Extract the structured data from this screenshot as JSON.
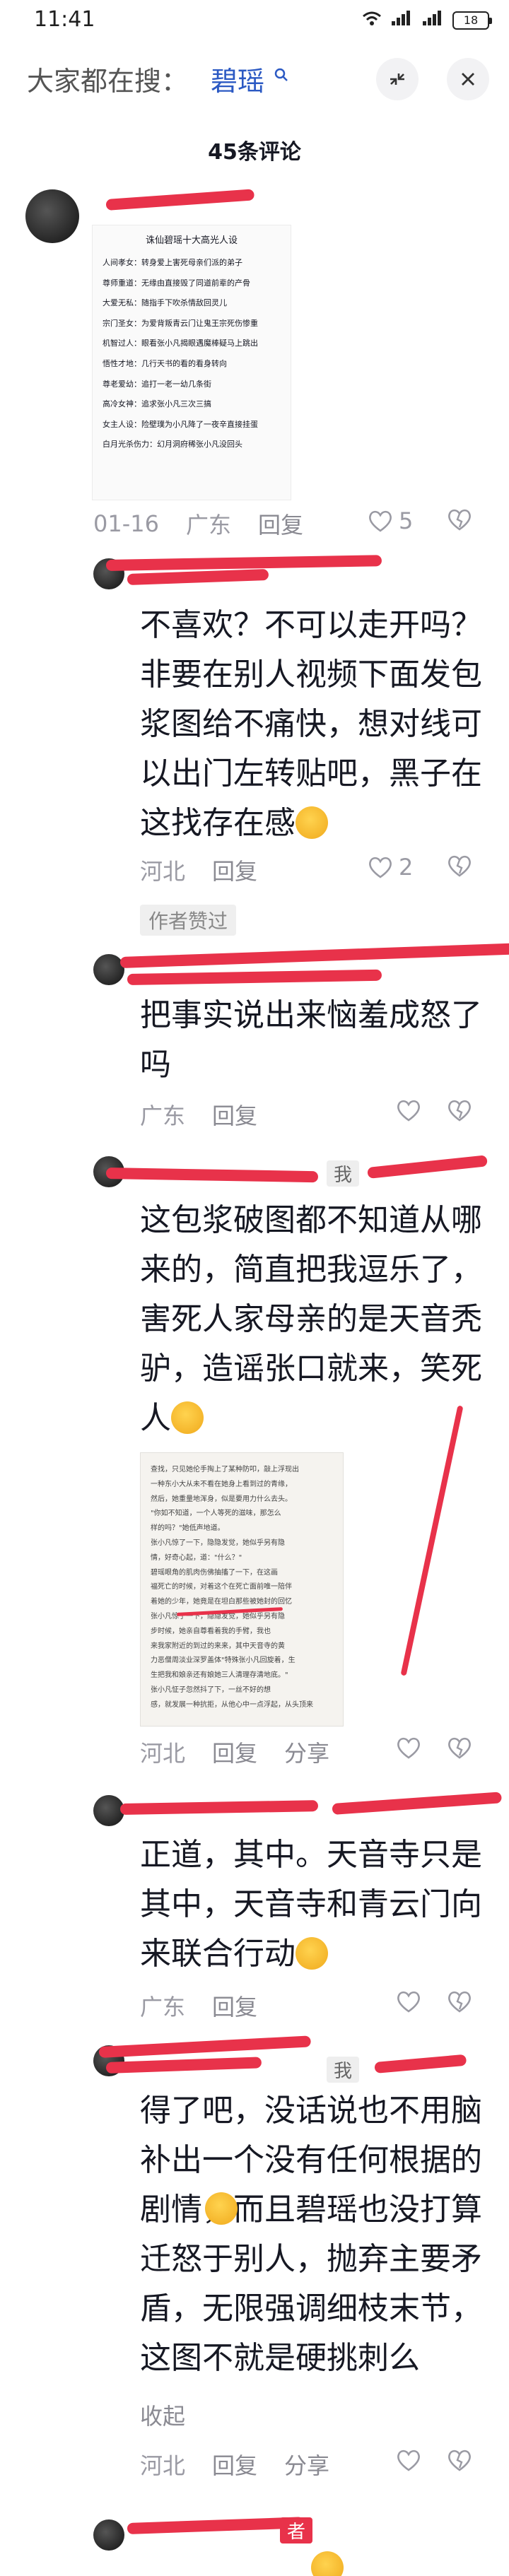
{
  "status": {
    "time": "11:41",
    "battery": "18"
  },
  "header": {
    "prefix": "大家都在搜：",
    "term": "碧瑶"
  },
  "title": "45条评论",
  "comments": [
    {
      "card_title": "诛仙碧瑶十大高光人设",
      "card_lines": [
        "人间孝女：转身爱上害死母亲们派的弟子",
        "尊师重道：无缘由直接毁了同道前辈的产骨",
        "大爱无私：随指手下吹杀情敌回灵儿",
        "宗门圣女：为爱背叛青云门让鬼王宗死伤惨重",
        "机智过人：眼看张小凡揭眼遇魔棒疑马上跳出",
        "悟性才地：几行天书的看的看身转向",
        "尊老爱幼：追打一老一幼几条街",
        "高冷女神：追求张小凡三次三搞",
        "女主人设：险壁璞为小凡降了一夜辛直接挂蛋",
        "白月光杀伤力：幻月洞府稀张小凡没回头"
      ],
      "date": "01-16",
      "region": "广东",
      "reply": "回复",
      "likes": "5"
    },
    {
      "text": "不喜欢？不可以走开吗？非要在别人视频下面发包浆图给不痛快，想对线可以出门左转贴吧，黑子在这找存在感",
      "region": "河北",
      "reply": "回复",
      "likes": "2",
      "badge": "作者赞过"
    },
    {
      "text": "把事实说出来恼羞成怒了吗",
      "region": "广东",
      "reply": "回复"
    },
    {
      "me": "我",
      "text": "这包浆破图都不知道从哪来的，简直把我逗乐了，害死人家母亲的是天音秃驴，造谣张口就来，笑死人",
      "card_lines": [
        "查找，只见她伦手掏上了某种防叩，敲上浮现出",
        "一种东小大从未不看在她身上看到过的青缘，",
        "然后，她重量地浑身，似是要用力什么去头。",
        "\"你如不知道，一个人等死的滋味，那怎么",
        "样的吗？\"她低声地道。",
        "张小凡惊了一下，隐隐发觉，她似乎另有隐",
        "情，好奇心起，道：\"什么？\"",
        "碧瑶眼角的肌肉伤佛抽搐了一下，在这画",
        "福死亡的时候，对着这个在死亡面前唯一陪伴",
        "着她的少年，她竟是在坦白那些被她封的回忆",
        "张小凡惊了一下，隐隐发觉，她似乎另有隐",
        "步时候，她亲自尊看着我的手臂，我也",
        "来我家附近的到过的来来，其中天音寺的黄",
        "力恶僧周淡业深罗盖体\"特殊张小凡回旋着，生",
        "生把我和娘亲还有娘她三人清理存清地底。\"",
        "张小凡怔子忽然抖了下，一丝不好的想",
        "感，就发展一种抗拒，从他心中一点浮起，从头顶来"
      ],
      "region": "河北",
      "reply": "回复",
      "share": "分享"
    },
    {
      "text": "正道，其中。天音寺只是其中，天音寺和青云门向来联合行动",
      "region": "广东",
      "reply": "回复"
    },
    {
      "me": "我",
      "text": "得了吧，没话说也不用脑补出一个没有任何根据的剧情，而且碧瑶也没打算迁怒于别人，抛弃主要矛盾，无限强调细枝末节，这图不就是硬挑刺么",
      "collapse": "收起",
      "region": "河北",
      "reply": "回复",
      "share": "分享"
    },
    {
      "bottom_badge": "者"
    }
  ]
}
